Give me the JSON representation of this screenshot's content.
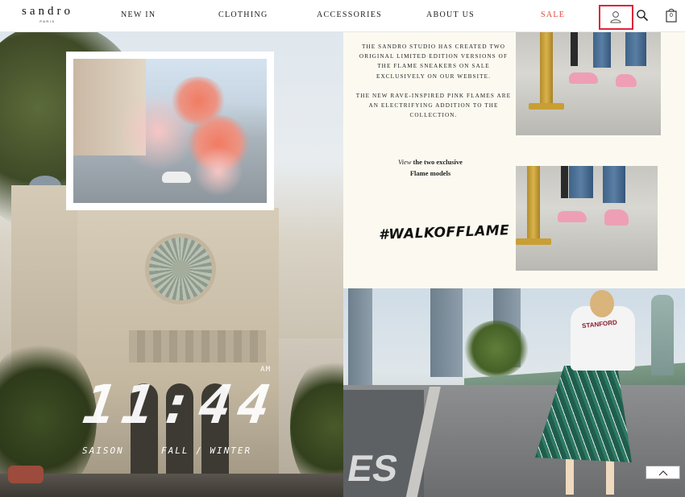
{
  "brand": {
    "logo": "sandro",
    "logo_sub": "PARIS"
  },
  "nav": {
    "items": [
      {
        "label": "NEW IN"
      },
      {
        "label": "CLOTHING"
      },
      {
        "label": "ACCESSORIES"
      },
      {
        "label": "ABOUT US"
      },
      {
        "label": "SALE"
      }
    ],
    "bag_count": "0",
    "icons": [
      "account-icon",
      "search-icon",
      "shopping-bag-icon"
    ],
    "sale_color": "#e0463b",
    "highlight_color": "#e0243a"
  },
  "hero": {
    "clock_ampm": "AM",
    "clock_time": "11:44",
    "saison_label": "SAISON",
    "season_label": "FALL / WINTER"
  },
  "promo": {
    "paragraph_1": "THE SANDRO STUDIO HAS CREATED TWO ORIGINAL LIMITED EDITION VERSIONS OF THE FLAME SNEAKERS ON SALE EXCLUSIVELY ON OUR WEBSITE.",
    "paragraph_2": "THE NEW RAVE-INSPIRED PINK FLAMES ARE AN ELECTRIFYING ADDITION TO THE COLLECTION.",
    "view_prefix": "View",
    "view_rest": "the two exclusive",
    "view_line2": "Flame models",
    "hashtag": "#WALKOFFLAME",
    "background": "#fcfaf0"
  },
  "street": {
    "bike_mark": "ES",
    "shirt_print": "STANFORD"
  },
  "back_to_top": {
    "icon": "chevron-up-icon"
  }
}
